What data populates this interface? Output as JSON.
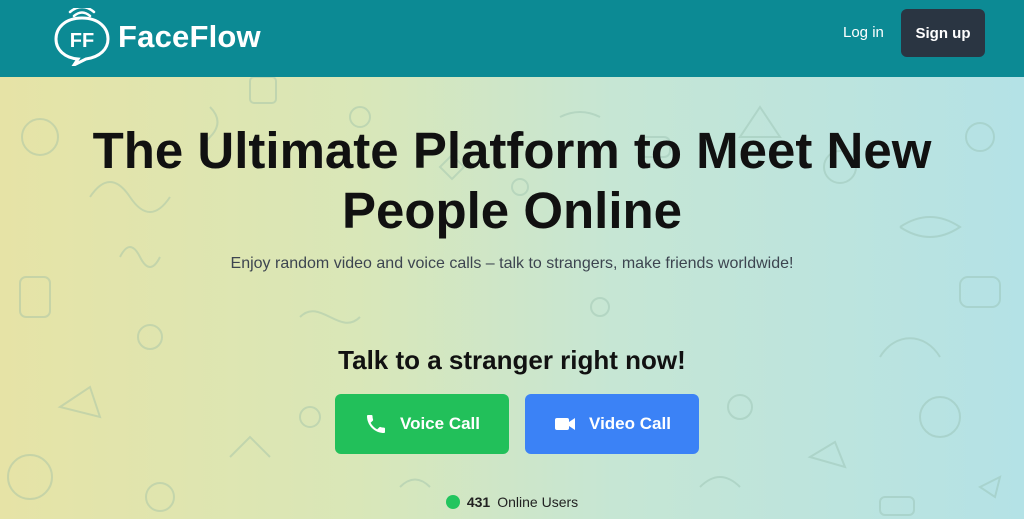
{
  "brand": {
    "name": "FaceFlow",
    "badge": "FF",
    "logo_icon": "wifi-speech-bubble-icon"
  },
  "nav": {
    "login_label": "Log in",
    "signup_label": "Sign up"
  },
  "hero": {
    "title": "The Ultimate Platform to Meet New People Online",
    "subtitle": "Enjoy random video and voice calls – talk to strangers, make friends worldwide!"
  },
  "cta": {
    "heading": "Talk to a stranger right now!",
    "voice_label": "Voice Call",
    "voice_icon": "phone-icon",
    "video_label": "Video Call",
    "video_icon": "video-camera-icon"
  },
  "online": {
    "count": "431",
    "label": "Online Users"
  },
  "colors": {
    "header": "#0c8a94",
    "signup": "#2a3542",
    "voice": "#22c05a",
    "video": "#3b82f6",
    "online_dot": "#22c55e"
  }
}
